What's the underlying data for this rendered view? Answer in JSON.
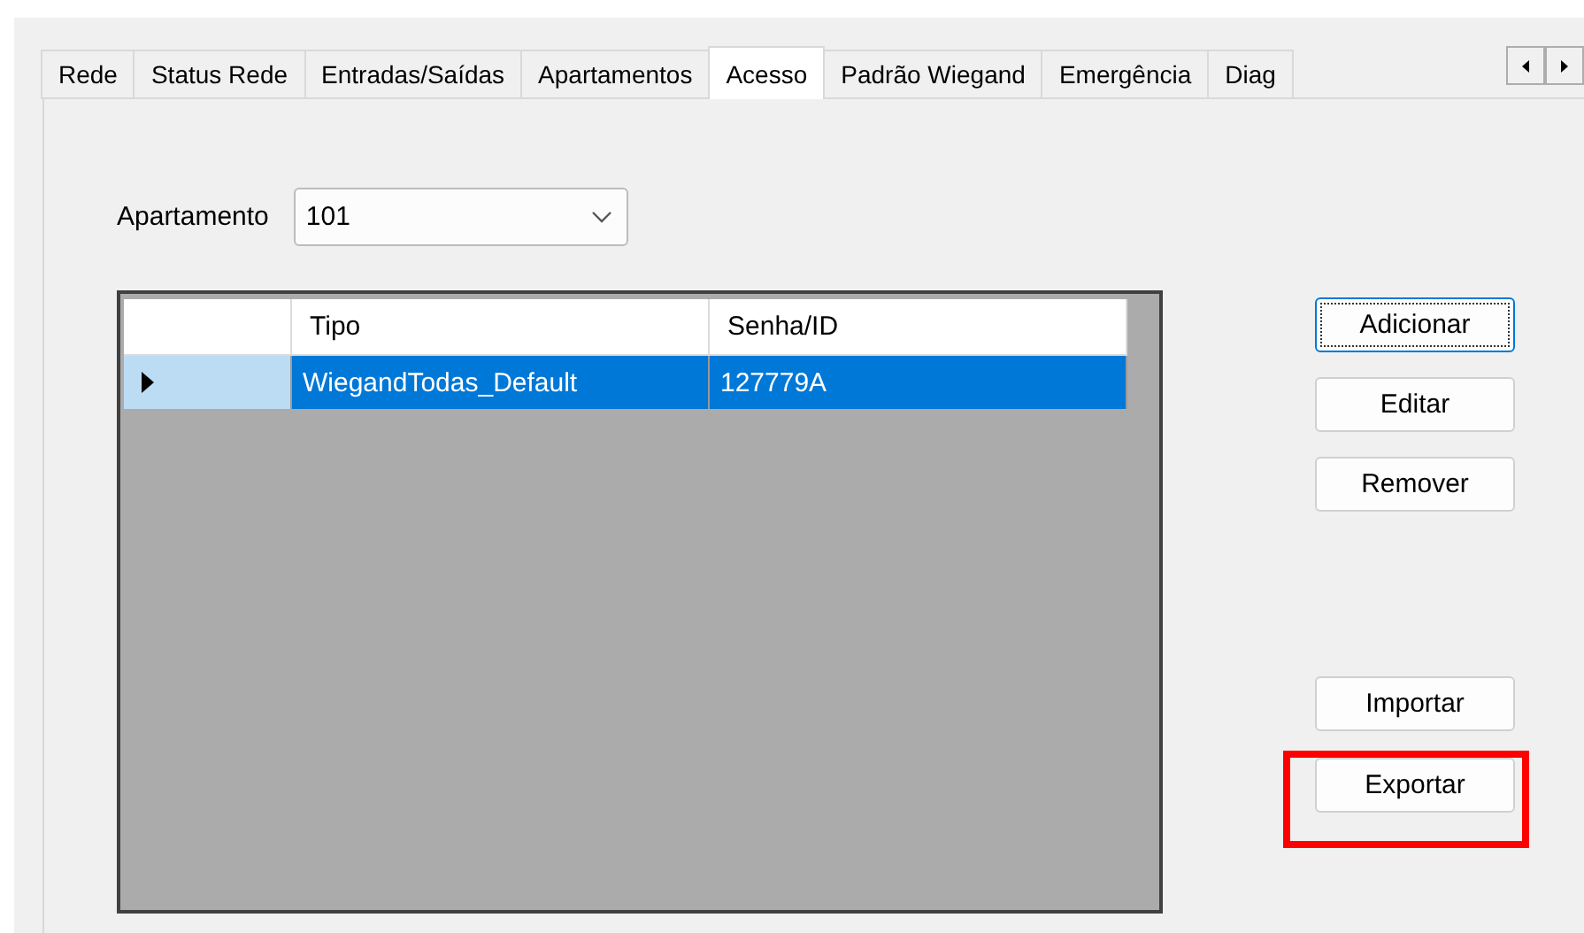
{
  "tabs": [
    {
      "label": "Rede",
      "selected": false
    },
    {
      "label": "Status Rede",
      "selected": false
    },
    {
      "label": "Entradas/Saídas",
      "selected": false
    },
    {
      "label": "Apartamentos",
      "selected": false
    },
    {
      "label": "Acesso",
      "selected": true
    },
    {
      "label": "Padrão Wiegand",
      "selected": false
    },
    {
      "label": "Emergência",
      "selected": false
    },
    {
      "label": "Diag",
      "selected": false
    }
  ],
  "apartment": {
    "label": "Apartamento",
    "value": "101"
  },
  "grid": {
    "columns": [
      "Tipo",
      "Senha/ID"
    ],
    "rows": [
      {
        "cells": [
          "WiegandTodas_Default",
          "127779A"
        ],
        "selected": true
      }
    ]
  },
  "buttons_top": [
    {
      "label": "Adicionar",
      "focused": true,
      "highlighted": false
    },
    {
      "label": "Editar",
      "focused": false,
      "highlighted": false
    },
    {
      "label": "Remover",
      "focused": false,
      "highlighted": false
    }
  ],
  "buttons_bottom": [
    {
      "label": "Importar",
      "focused": false,
      "highlighted": false
    },
    {
      "label": "Exportar",
      "focused": false,
      "highlighted": true
    }
  ]
}
